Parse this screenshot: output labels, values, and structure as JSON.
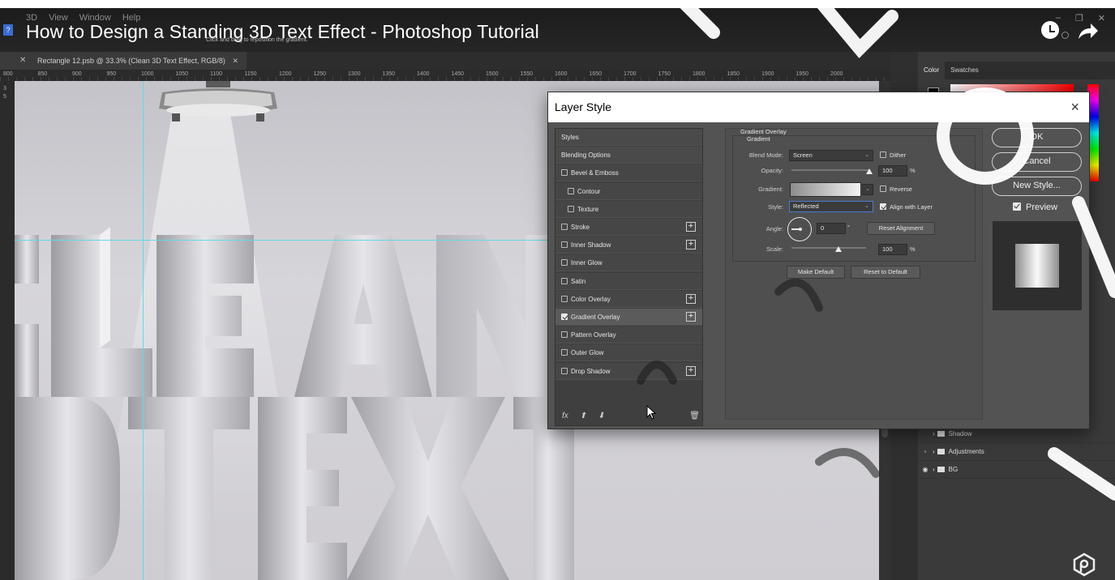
{
  "video": {
    "title": "How to Design a Standing 3D Text Effect - Photoshop Tutorial",
    "hint": "Click and drag to reposition the gradient.",
    "menus": [
      "3D",
      "View",
      "Window",
      "Help"
    ]
  },
  "document": {
    "tab_title": "Rectangle 12.psb @ 33.3% (Clean 3D Text Effect, RGB/8)",
    "ruler_numbers": [
      "800",
      "850",
      "900",
      "950",
      "1000",
      "1050",
      "1100",
      "1150",
      "1200",
      "1250",
      "1300",
      "1350",
      "1400",
      "1450",
      "1500",
      "1550",
      "1600",
      "1650",
      "1700",
      "1750",
      "1800",
      "1850",
      "1900",
      "1950",
      "2000"
    ],
    "vruler_numbers": [
      "3",
      "5"
    ]
  },
  "right_panel": {
    "tabs": [
      "Color",
      "Swatches"
    ],
    "layers": [
      {
        "name": "Shadow",
        "eye": false
      },
      {
        "name": "Adjustments",
        "eye": false
      },
      {
        "name": "BG",
        "eye": true
      }
    ]
  },
  "dialog": {
    "title": "Layer Style",
    "styles": [
      {
        "label": "Styles",
        "checkbox": false,
        "header": true,
        "plus": false
      },
      {
        "label": "Blending Options",
        "checkbox": false,
        "header": true,
        "plus": false
      },
      {
        "label": "Bevel & Emboss",
        "checkbox": true,
        "checked": false,
        "plus": false
      },
      {
        "label": "Contour",
        "checkbox": true,
        "checked": false,
        "plus": false,
        "indent": true
      },
      {
        "label": "Texture",
        "checkbox": true,
        "checked": false,
        "plus": false,
        "indent": true
      },
      {
        "label": "Stroke",
        "checkbox": true,
        "checked": false,
        "plus": true
      },
      {
        "label": "Inner Shadow",
        "checkbox": true,
        "checked": false,
        "plus": true
      },
      {
        "label": "Inner Glow",
        "checkbox": true,
        "checked": false,
        "plus": false
      },
      {
        "label": "Satin",
        "checkbox": true,
        "checked": false,
        "plus": false
      },
      {
        "label": "Color Overlay",
        "checkbox": true,
        "checked": false,
        "plus": true
      },
      {
        "label": "Gradient Overlay",
        "checkbox": true,
        "checked": true,
        "plus": true,
        "selected": true
      },
      {
        "label": "Pattern Overlay",
        "checkbox": true,
        "checked": false,
        "plus": false
      },
      {
        "label": "Outer Glow",
        "checkbox": true,
        "checked": false,
        "plus": false
      },
      {
        "label": "Drop Shadow",
        "checkbox": true,
        "checked": false,
        "plus": true
      }
    ],
    "footer": {
      "fx": "fx",
      "up": "⬆",
      "down": "⬇",
      "trash": "🗑"
    },
    "section_title": "Gradient Overlay",
    "group_title": "Gradient",
    "blend_mode_label": "Blend Mode:",
    "blend_mode_value": "Screen",
    "dither_label": "Dither",
    "opacity_label": "Opacity:",
    "opacity_value": "100",
    "opacity_unit": "%",
    "opacity_level": 1.0,
    "gradient_label": "Gradient:",
    "reverse_label": "Reverse",
    "style_label": "Style:",
    "style_value": "Reflected",
    "align_label": "Align with Layer",
    "angle_label": "Angle:",
    "angle_value": "0",
    "angle_unit": "°",
    "reset_alignment": "Reset Alignment",
    "scale_label": "Scale:",
    "scale_value": "100",
    "scale_unit": "%",
    "make_default": "Make Default",
    "reset_default": "Reset to Default",
    "ok": "OK",
    "cancel": "Cancel",
    "new_style": "New Style...",
    "preview": "Preview",
    "close": "×"
  },
  "colors": {
    "accent": "#4a7bd0",
    "guide": "#6dd5e5"
  }
}
